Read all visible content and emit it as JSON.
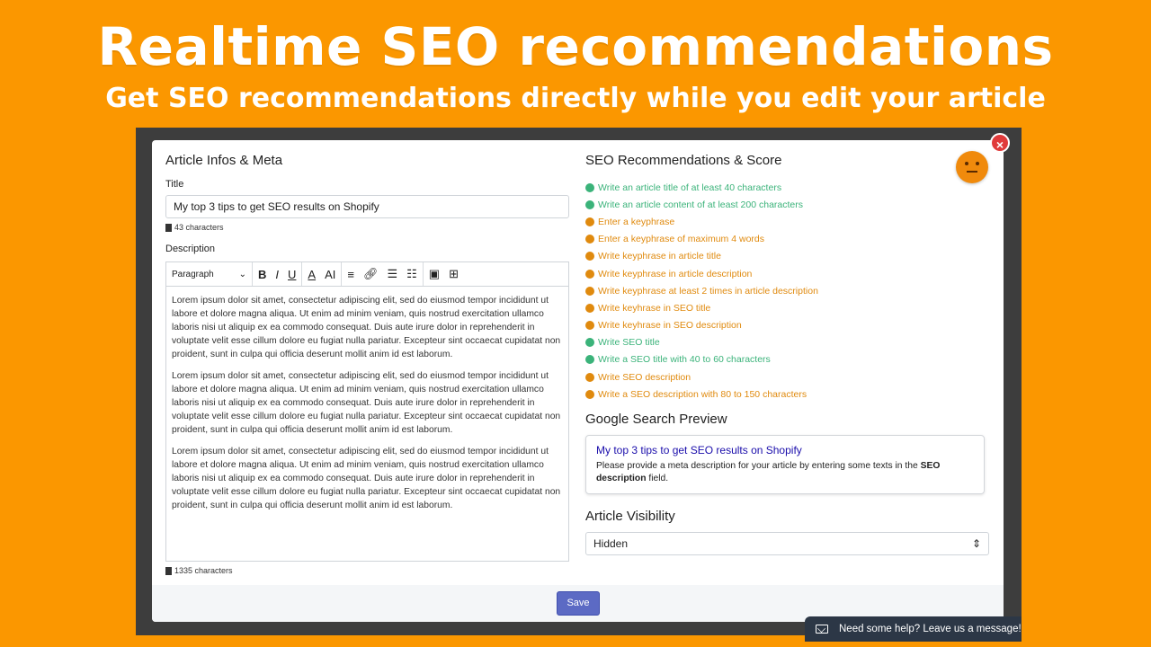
{
  "banner": {
    "title": "Realtime SEO recommendations",
    "subtitle": "Get SEO recommendations directly while you edit your article"
  },
  "colors": {
    "background": "#fb9700",
    "good": "#3bb37a",
    "warning": "#e08a0e",
    "save_button": "#5c6ac4"
  },
  "article": {
    "section_title": "Article Infos & Meta",
    "title_label": "Title",
    "title_value": "My top 3 tips to get SEO results on Shopify",
    "title_count": "43 characters",
    "description_label": "Description",
    "toolbar": {
      "format_select": "Paragraph",
      "bold": "B",
      "italic": "I",
      "underline": "U",
      "font_color": "A",
      "font_size": "AI"
    },
    "paragraphs": [
      "Lorem ipsum dolor sit amet, consectetur adipiscing elit, sed do eiusmod tempor incididunt ut labore et dolore magna aliqua. Ut enim ad minim veniam, quis nostrud exercitation ullamco laboris nisi ut aliquip ex ea commodo consequat. Duis aute irure dolor in reprehenderit in voluptate velit esse cillum dolore eu fugiat nulla pariatur. Excepteur sint occaecat cupidatat non proident, sunt in culpa qui officia deserunt mollit anim id est laborum.",
      "Lorem ipsum dolor sit amet, consectetur adipiscing elit, sed do eiusmod tempor incididunt ut labore et dolore magna aliqua. Ut enim ad minim veniam, quis nostrud exercitation ullamco laboris nisi ut aliquip ex ea commodo consequat. Duis aute irure dolor in reprehenderit in voluptate velit esse cillum dolore eu fugiat nulla pariatur. Excepteur sint occaecat cupidatat non proident, sunt in culpa qui officia deserunt mollit anim id est laborum.",
      "Lorem ipsum dolor sit amet, consectetur adipiscing elit, sed do eiusmod tempor incididunt ut labore et dolore magna aliqua. Ut enim ad minim veniam, quis nostrud exercitation ullamco laboris nisi ut aliquip ex ea commodo consequat. Duis aute irure dolor in reprehenderit in voluptate velit esse cillum dolore eu fugiat nulla pariatur. Excepteur sint occaecat cupidatat non proident, sunt in culpa qui officia deserunt mollit anim id est laborum."
    ],
    "description_count": "1335 characters"
  },
  "seo": {
    "section_title": "SEO Recommendations & Score",
    "recommendations": [
      {
        "text": "Write an article title of at least 40 characters",
        "status": "good"
      },
      {
        "text": "Write an article content of at least 200 characters",
        "status": "good"
      },
      {
        "text": "Enter a keyphrase",
        "status": "bad"
      },
      {
        "text": "Enter a keyphrase of maximum 4 words",
        "status": "bad"
      },
      {
        "text": "Write keyphrase in article title",
        "status": "bad"
      },
      {
        "text": "Write keyphrase in article description",
        "status": "bad"
      },
      {
        "text": "Write keyphrase at least 2 times in article description",
        "status": "bad"
      },
      {
        "text": "Write keyhrase in SEO title",
        "status": "bad"
      },
      {
        "text": "Write keyhrase in SEO description",
        "status": "bad"
      },
      {
        "text": "Write SEO title",
        "status": "good"
      },
      {
        "text": "Write a SEO title with 40 to 60 characters",
        "status": "good"
      },
      {
        "text": "Write SEO description",
        "status": "bad"
      },
      {
        "text": "Write a SEO description with 80 to 150 characters",
        "status": "bad"
      }
    ],
    "preview_title": "Google Search Preview",
    "preview": {
      "link": "My top 3 tips to get SEO results on Shopify",
      "desc_before": "Please provide a meta description for your article by entering some texts in the ",
      "desc_bold": "SEO description",
      "desc_after": " field."
    },
    "visibility_title": "Article Visibility",
    "visibility_value": "Hidden"
  },
  "footer": {
    "save_label": "Save",
    "help_label": "Need some help? Leave us a message!"
  }
}
